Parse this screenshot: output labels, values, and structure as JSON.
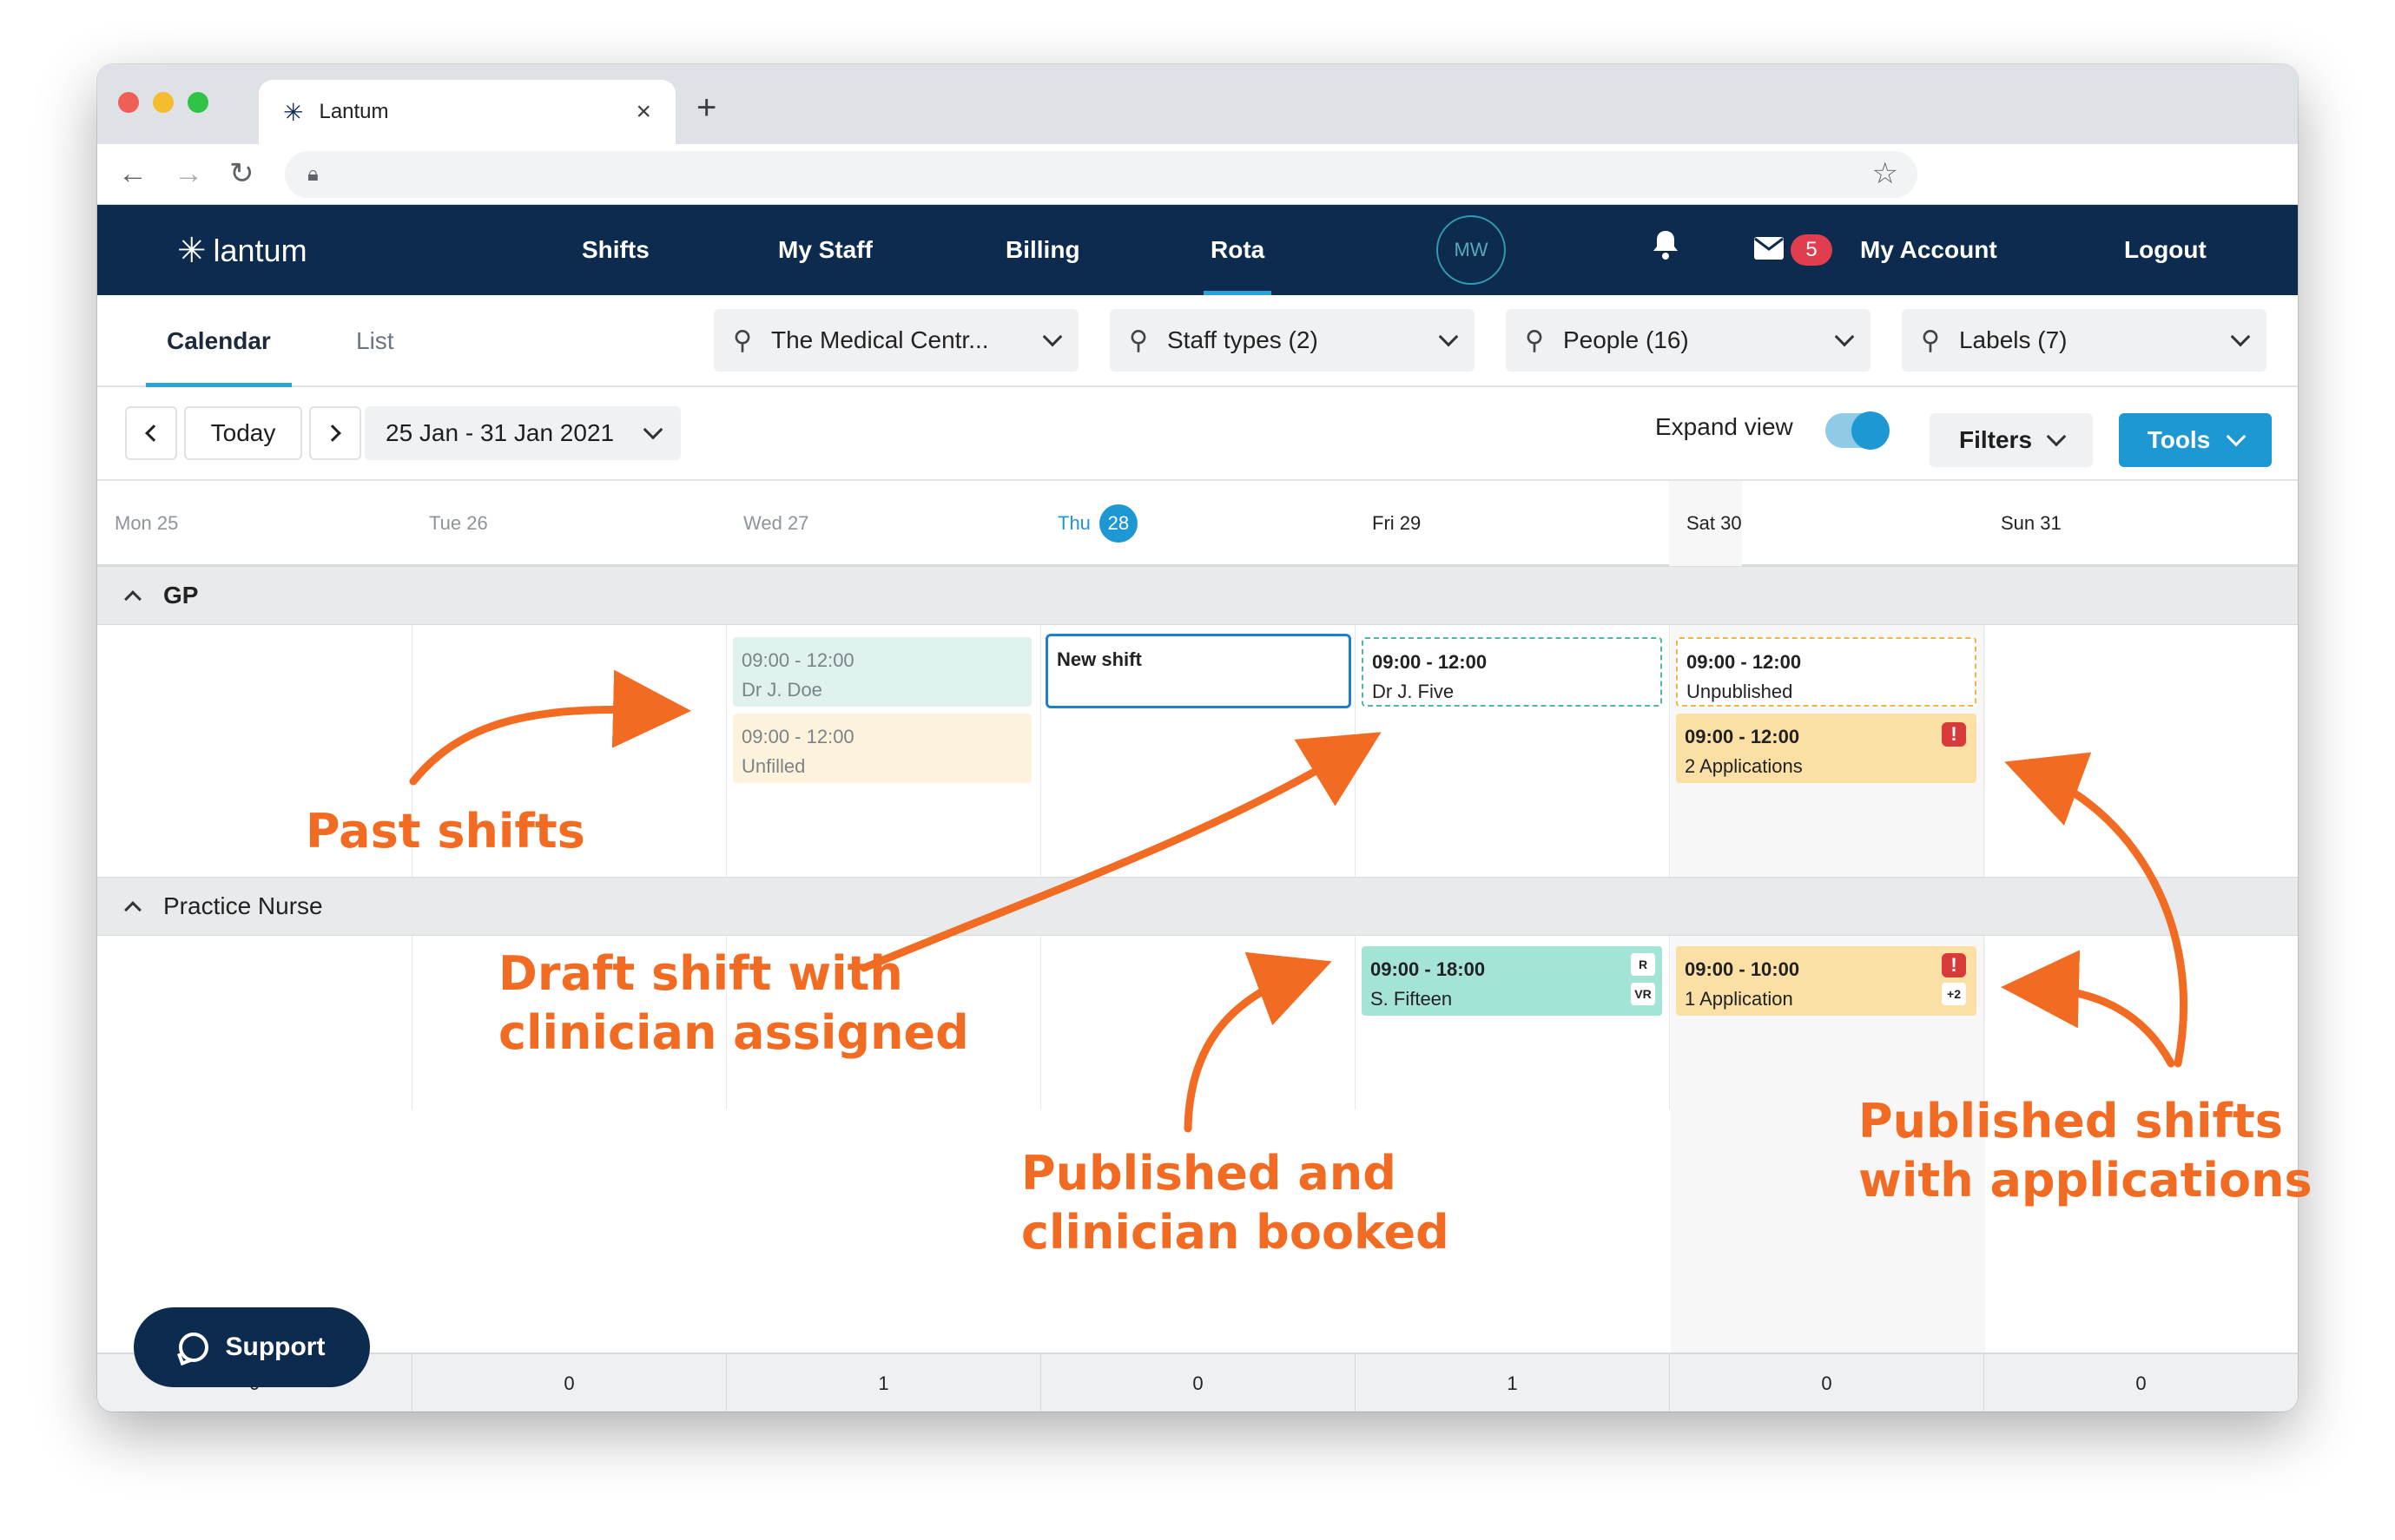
{
  "browser": {
    "tab_title": "Lantum",
    "tab_close": "×",
    "new_tab": "+"
  },
  "nav": {
    "logo": "lantum",
    "items": [
      "Shifts",
      "My Staff",
      "Billing",
      "Rota"
    ],
    "active": "Rota",
    "avatar_initials": "MW",
    "mail_count": "5",
    "account": "My Account",
    "logout": "Logout"
  },
  "views": {
    "calendar": "Calendar",
    "list": "List"
  },
  "filters": {
    "location": "The Medical Centr...",
    "staff_types": "Staff types (2)",
    "people": "People (16)",
    "labels": "Labels (7)"
  },
  "toolbar": {
    "today": "Today",
    "date_range": "25 Jan - 31 Jan 2021",
    "expand_view": "Expand view",
    "expand_on": true,
    "filters": "Filters",
    "tools": "Tools"
  },
  "days": [
    {
      "label": "Mon 25",
      "state": "past"
    },
    {
      "label": "Tue 26",
      "state": "past"
    },
    {
      "label": "Wed 27",
      "state": "past"
    },
    {
      "label": "Thu",
      "num": "28",
      "state": "today"
    },
    {
      "label": "Fri 29",
      "state": "future"
    },
    {
      "label": "Sat 30",
      "state": "future"
    },
    {
      "label": "Sun 31",
      "state": "future"
    }
  ],
  "groups": {
    "gp": "GP",
    "nurse": "Practice Nurse"
  },
  "shifts": {
    "gp_wed_1": {
      "time": "09:00 - 12:00",
      "sub": "Dr J. Doe"
    },
    "gp_wed_2": {
      "time": "09:00 - 12:00",
      "sub": "Unfilled"
    },
    "gp_thu_new": {
      "label": "New shift"
    },
    "gp_fri_1": {
      "time": "09:00 - 12:00",
      "sub": "Dr J. Five"
    },
    "gp_sat_1": {
      "time": "09:00 - 12:00",
      "sub": "Unpublished"
    },
    "gp_sat_2": {
      "time": "09:00 - 12:00",
      "sub": "2 Applications",
      "alert": "!"
    },
    "nurse_fri_1": {
      "time": "09:00 - 18:00",
      "sub": "S. Fifteen",
      "tag1": "R",
      "tag2": "VR"
    },
    "nurse_sat_1": {
      "time": "09:00 - 10:00",
      "sub": "1 Application",
      "alert": "!",
      "tag": "+2"
    }
  },
  "totals": [
    "0",
    "0",
    "1",
    "0",
    "1",
    "0",
    "0"
  ],
  "support": "Support",
  "annotations": {
    "past": "Past shifts",
    "draft_1": "Draft shift with",
    "draft_2": "clinician assigned",
    "booked_1": "Published and",
    "booked_2": "clinician booked",
    "apps_1": "Published shifts",
    "apps_2": "with applications"
  },
  "colors": {
    "navy": "#0d2b4e",
    "accent": "#1e98d3",
    "annotation": "#f26b22",
    "applied": "#fbe0a6",
    "booked": "#a3e4d6"
  }
}
